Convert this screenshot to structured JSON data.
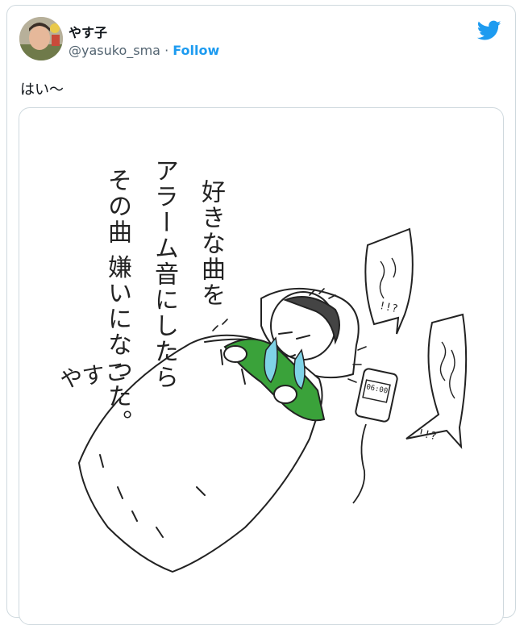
{
  "tweet": {
    "display_name": "やす子",
    "handle": "@yasuko_sma",
    "separator": "·",
    "follow_label": "Follow",
    "text": "はい〜"
  },
  "illustration": {
    "line1": "好きな曲を",
    "line2": "アラーム音にしたら",
    "line3": "その曲 嫌いになった。",
    "signature": "やすこ",
    "phone_time": "06:00",
    "exclaim1": "!!?",
    "exclaim2": "!!?"
  },
  "colors": {
    "twitter_blue": "#1d9bf0",
    "shirt_green": "#3aa23a",
    "tear_blue": "#7fd3e6",
    "border": "#cfd9de"
  },
  "icons": {
    "brand": "twitter-bird-icon"
  }
}
